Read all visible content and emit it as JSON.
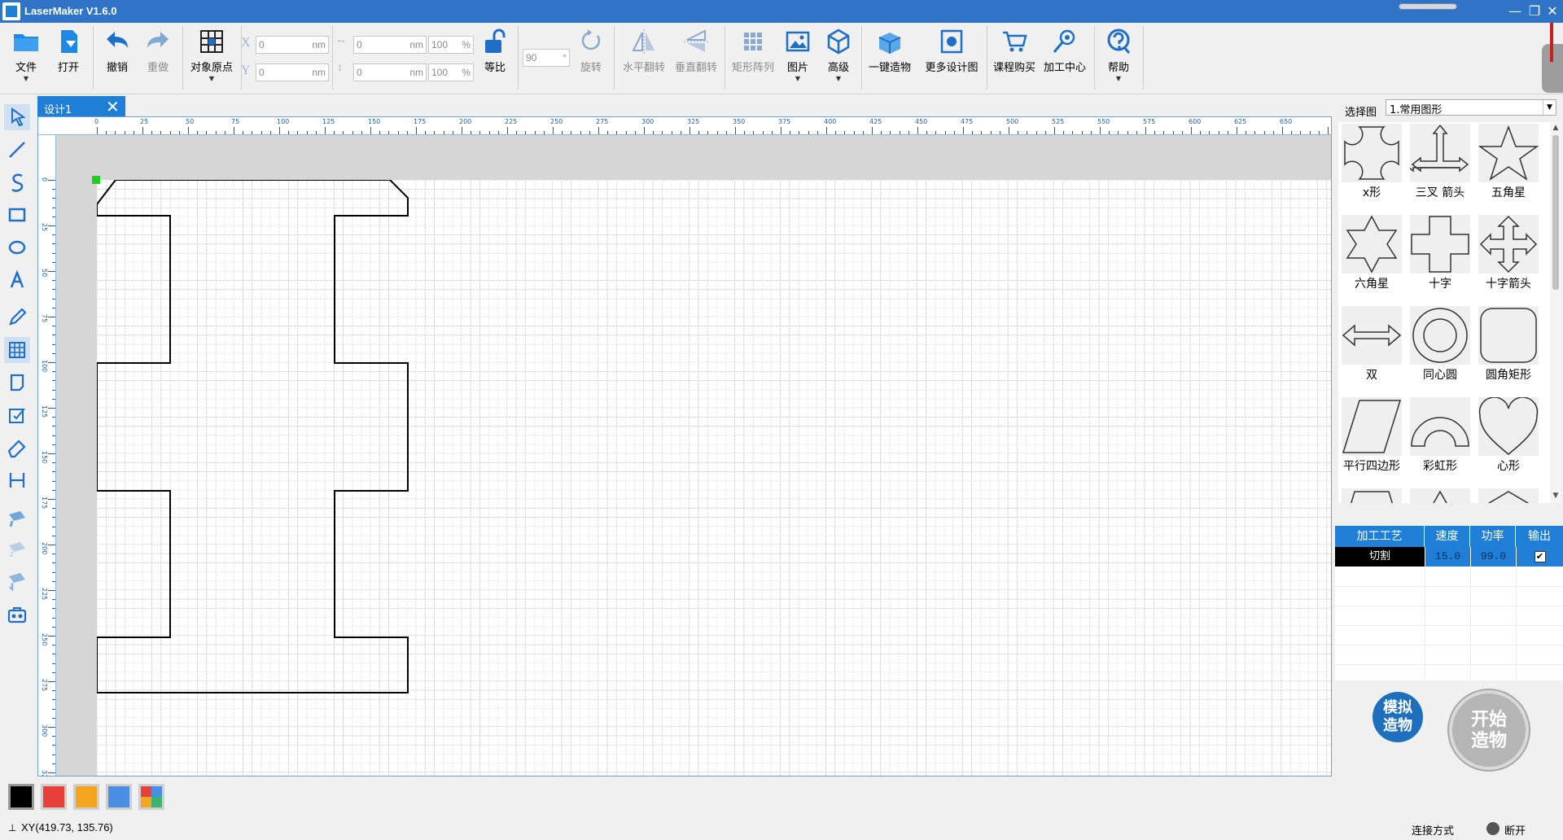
{
  "window": {
    "title": "LaserMaker V1.6.0",
    "controls": {
      "minimize": "—",
      "maximize": "❐",
      "close": "✕"
    }
  },
  "toolbar": {
    "file": "文件",
    "open": "打开",
    "undo": "撤销",
    "redo": "重做",
    "origin": "对象原点",
    "x_label": "X",
    "y_label": "Y",
    "x_value": "0",
    "y_value": "0",
    "unit_nm": "nm",
    "width_value": "0",
    "height_value": "0",
    "width_pct": "100",
    "height_pct": "100",
    "pct": "%",
    "lock_ratio": "等比",
    "rotate_value": "90",
    "rotate_unit": "°",
    "rotate": "旋转",
    "flip_h": "水平翻转",
    "flip_v": "垂直翻转",
    "array": "矩形阵列",
    "image": "图片",
    "advanced": "高级",
    "one_click": "一键造物",
    "more_designs": "更多设计图",
    "course_buy": "课程购买",
    "process_center": "加工中心",
    "help": "帮助"
  },
  "document": {
    "tab_title": "设计1",
    "tab_close": "✕"
  },
  "ruler": {
    "top_ticks": [
      "0",
      "25",
      "50",
      "75",
      "100",
      "125",
      "150",
      "175",
      "200",
      "225",
      "250",
      "275",
      "300",
      "325",
      "350",
      "375",
      "400",
      "425",
      "450",
      "475",
      "500",
      "525",
      "550",
      "575",
      "600",
      "625",
      "650"
    ],
    "left_ticks": [
      "0",
      "25",
      "50",
      "75",
      "100",
      "125",
      "150",
      "175",
      "200",
      "225",
      "250",
      "275",
      "300",
      "325"
    ]
  },
  "right_panel": {
    "select_label": "选择图",
    "select_value": "1.常用图形",
    "shapes": [
      {
        "name": "x形",
        "icon": "x-shape-icon"
      },
      {
        "name": "三叉 箭头",
        "icon": "trident-arrow-icon"
      },
      {
        "name": "五角星",
        "icon": "five-point-star-icon"
      },
      {
        "name": "六角星",
        "icon": "six-point-star-icon"
      },
      {
        "name": "十字",
        "icon": "cross-icon"
      },
      {
        "name": "十字箭头",
        "icon": "cross-arrow-icon"
      },
      {
        "name": "双",
        "icon": "double-arrow-icon"
      },
      {
        "name": "同心圆",
        "icon": "concentric-circles-icon"
      },
      {
        "name": "圆角矩形",
        "icon": "rounded-rect-icon"
      },
      {
        "name": "平行四边形",
        "icon": "parallelogram-icon"
      },
      {
        "name": "彩虹形",
        "icon": "rainbow-icon"
      },
      {
        "name": "心形",
        "icon": "heart-icon"
      }
    ],
    "process_table": {
      "headers": [
        "加工工艺",
        "速度",
        "功率",
        "输出"
      ],
      "rows": [
        {
          "process": "切割",
          "speed": "15.0",
          "power": "99.0",
          "output": true
        }
      ]
    },
    "simulate": "模拟造物",
    "simulate_lines": [
      "模拟",
      "造物"
    ],
    "start_lines": [
      "开始",
      "造物"
    ]
  },
  "colors": {
    "accent": "#1f7fd6",
    "swatches": [
      "#000000",
      "#e8403a",
      "#f5a41e",
      "#4a8ee6",
      "multi"
    ]
  },
  "status": {
    "coords": "XY(419.73, 135.76)",
    "connection_label": "连接方式",
    "connection_state": "断开"
  }
}
